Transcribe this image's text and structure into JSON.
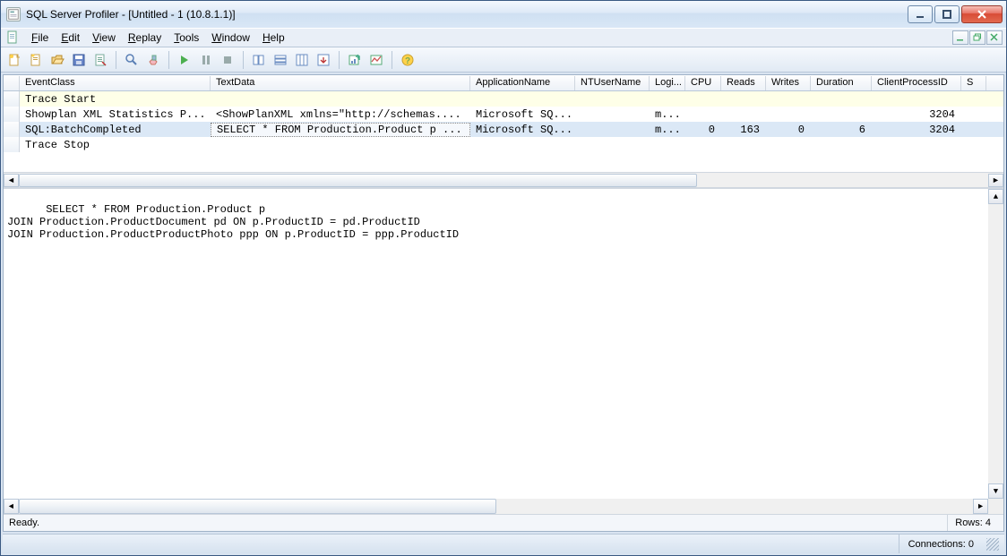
{
  "window": {
    "title": "SQL Server Profiler - [Untitled - 1 (10.8.1.1)]"
  },
  "menu": {
    "file": "File",
    "edit": "Edit",
    "view": "View",
    "replay": "Replay",
    "tools": "Tools",
    "window": "Window",
    "help": "Help"
  },
  "columns": {
    "event": "EventClass",
    "text": "TextData",
    "app": "ApplicationName",
    "nt": "NTUserName",
    "login": "Logi...",
    "cpu": "CPU",
    "reads": "Reads",
    "writes": "Writes",
    "duration": "Duration",
    "cpid": "ClientProcessID",
    "spid": "S"
  },
  "rows": [
    {
      "event": "Trace Start",
      "text": "",
      "app": "",
      "nt": "",
      "login": "",
      "cpu": "",
      "reads": "",
      "writes": "",
      "duration": "",
      "cpid": ""
    },
    {
      "event": "Showplan XML Statistics P...",
      "text": "<ShowPlanXML xmlns=\"http://schemas....",
      "app": "Microsoft SQ...",
      "nt": "",
      "login": "m...",
      "cpu": "",
      "reads": "",
      "writes": "",
      "duration": "",
      "cpid": "3204"
    },
    {
      "event": "SQL:BatchCompleted",
      "text": "SELECT * FROM Production.Product p ...",
      "app": "Microsoft SQ...",
      "nt": "",
      "login": "m...",
      "cpu": "0",
      "reads": "163",
      "writes": "0",
      "duration": "6",
      "cpid": "3204",
      "selected": true
    },
    {
      "event": "Trace Stop",
      "text": "",
      "app": "",
      "nt": "",
      "login": "",
      "cpu": "",
      "reads": "",
      "writes": "",
      "duration": "",
      "cpid": ""
    }
  ],
  "detail": "SELECT * FROM Production.Product p\nJOIN Production.ProductDocument pd ON p.ProductID = pd.ProductID\nJOIN Production.ProductProductPhoto ppp ON p.ProductID = ppp.ProductID",
  "doc_status": {
    "ready": "Ready.",
    "rows_label": "Rows: 4"
  },
  "app_status": {
    "connections": "Connections: 0"
  }
}
